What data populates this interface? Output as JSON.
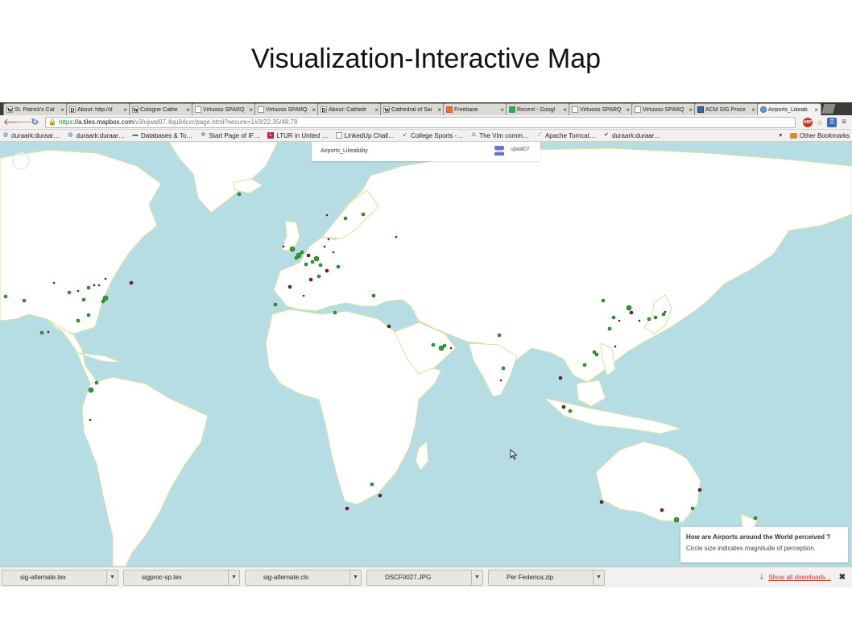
{
  "slide": {
    "title": "Visualization-Interactive Map"
  },
  "browser": {
    "tabs": [
      {
        "label": "St. Patrick's Cat",
        "icon": "W",
        "active": false
      },
      {
        "label": "About: http://d",
        "icon": "D",
        "active": false
      },
      {
        "label": "Cologne Cathe",
        "icon": "W",
        "active": false
      },
      {
        "label": "Virtuoso SPARQ",
        "icon": "page",
        "active": false
      },
      {
        "label": "Virtuoso SPARQ",
        "icon": "page",
        "active": false
      },
      {
        "label": "About: Cathedr",
        "icon": "D",
        "active": false
      },
      {
        "label": "Cathedral of Sai",
        "icon": "W",
        "active": false
      },
      {
        "label": "Freebase",
        "icon": "freebase",
        "active": false
      },
      {
        "label": "Recent - Googl",
        "icon": "drive",
        "active": false
      },
      {
        "label": "Virtuoso SPARQ",
        "icon": "page",
        "active": false
      },
      {
        "label": "Virtuoso SPARQ",
        "icon": "page",
        "active": false
      },
      {
        "label": "ACM SIG Proce",
        "icon": "acm",
        "active": false
      },
      {
        "label": "Airports_Likeab",
        "icon": "mapbox",
        "active": true
      }
    ],
    "url": {
      "scheme": "https",
      "host": "://a.tiles.mapbox.com",
      "path": "/v3/ujwal07.4qu84cxr/page.html?secure=1#3/22.35/48.78"
    },
    "bookmarks": [
      {
        "label": "duraark:duraar…",
        "icon": "globe"
      },
      {
        "label": "duraark:duraar…",
        "icon": "globe"
      },
      {
        "label": "Databases & To…",
        "icon": "db"
      },
      {
        "label": "Start Page of IF…",
        "icon": "gear"
      },
      {
        "label": "LTUR in United …",
        "icon": "ltur"
      },
      {
        "label": "LinkedUp Chall…",
        "icon": "page"
      },
      {
        "label": "College Sports -…",
        "icon": "sports"
      },
      {
        "label": "The Vim comm…",
        "icon": "vim"
      },
      {
        "label": "Apache Tomcat…",
        "icon": "feather"
      },
      {
        "label": "duraark:duraar…",
        "icon": "check"
      }
    ],
    "other_bookmarks": "Other Bookmarks",
    "downloads": [
      "sig-alternate.tex",
      "sigproc-sp.tex",
      "sig-alternate.cls",
      "DSCF0027.JPG",
      "Per Federica.zip"
    ],
    "show_all_downloads": "Show all downloads..."
  },
  "map": {
    "title": "Airports_Likeability",
    "user": "ujwal07",
    "legend_question": "How are Airports around the World perceived ?",
    "legend_subtitle": "Circle size indicates magnitude of perception.",
    "colors": {
      "ocean": "#b7dde4",
      "land": "#ffffff",
      "coast": "#d9e6a8",
      "positive": "#2fa02f",
      "negative": "#7a1f33"
    }
  }
}
